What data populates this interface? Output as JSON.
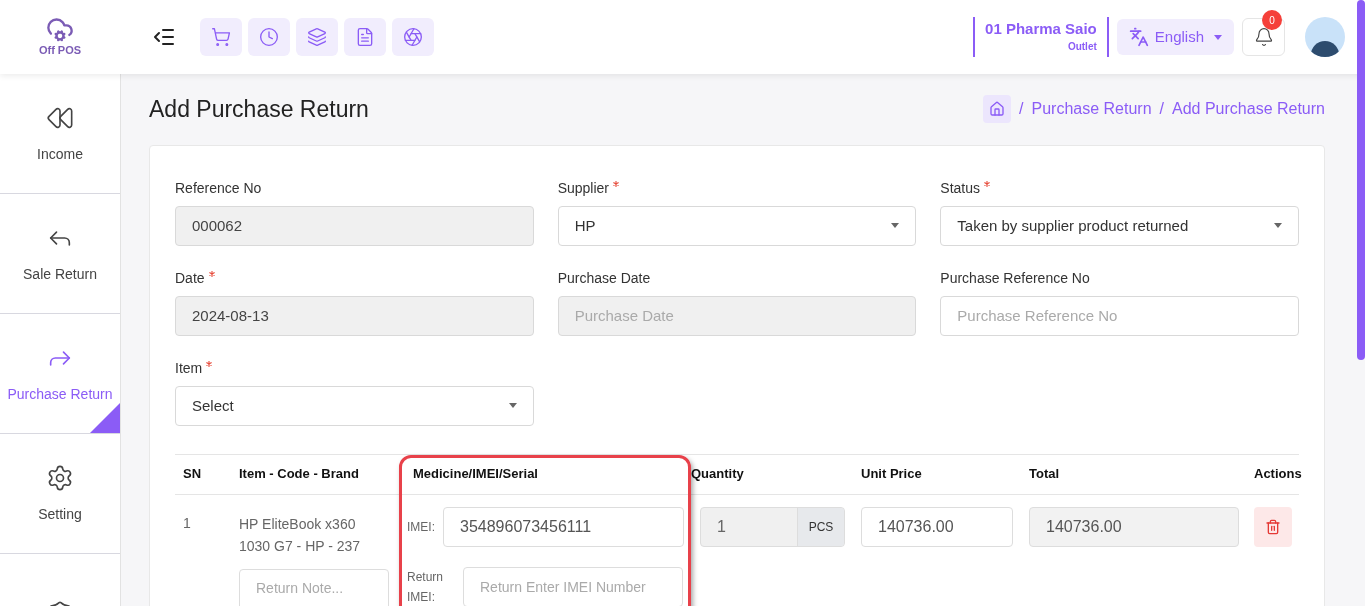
{
  "header": {
    "logo_text": "Off POS",
    "outlet": {
      "name": "01 Pharma Saio",
      "type": "Outlet"
    },
    "language": "English",
    "notification_count": "0"
  },
  "sidebar": {
    "items": [
      {
        "label": "Income",
        "selected": false
      },
      {
        "label": "Sale Return",
        "selected": false
      },
      {
        "label": "Purchase Return",
        "selected": true
      },
      {
        "label": "Setting",
        "selected": false
      },
      {
        "selected": false
      }
    ]
  },
  "page": {
    "title": "Add Purchase Return",
    "breadcrumb": [
      {
        "separator": "/",
        "label": "Purchase Return"
      },
      {
        "separator": "/",
        "label": "Add Purchase Return"
      }
    ]
  },
  "form": {
    "fields": [
      {
        "label": "Reference No",
        "required": false,
        "kind": "input",
        "value": "000062",
        "disabled": true
      },
      {
        "label": "Supplier",
        "required": true,
        "kind": "select",
        "value": "HP",
        "disabled": false
      },
      {
        "label": "Status",
        "required": true,
        "kind": "select",
        "value": "Taken by supplier product returned",
        "disabled": false
      },
      {
        "label": "Date",
        "required": true,
        "kind": "input",
        "value": "2024-08-13",
        "disabled": true
      },
      {
        "label": "Purchase Date",
        "required": false,
        "kind": "input",
        "placeholder": "Purchase Date",
        "disabled": true
      },
      {
        "label": "Purchase Reference No",
        "required": false,
        "kind": "input",
        "placeholder": "Purchase Reference No",
        "disabled": false
      },
      {
        "label": "Item",
        "required": true,
        "kind": "select",
        "value": "Select",
        "disabled": false
      }
    ]
  },
  "table": {
    "columns": [
      "SN",
      "Item - Code - Brand",
      "Medicine/IMEI/Serial",
      "Quantity",
      "Unit Price",
      "Total",
      "Actions"
    ],
    "rows": [
      {
        "sn": "1",
        "item": "HP EliteBook x360 1030 G7 - HP - 237",
        "note_placeholder": "Return Note...",
        "imei_label": "IMEI:",
        "imei": "354896073456111",
        "return_label": "Return IMEI:",
        "return_placeholder": "Return Enter IMEI Number",
        "quantity": "1",
        "unit": "PCS",
        "unit_price": "140736.00",
        "total": "140736.00"
      }
    ]
  }
}
